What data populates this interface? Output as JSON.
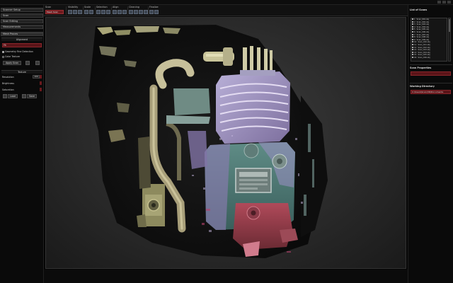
{
  "toolbar": {
    "groups": [
      {
        "label": "Scan",
        "selected": "Mesh Scan"
      },
      {
        "label": "Visibility"
      },
      {
        "label": "Scale"
      },
      {
        "label": "Selection"
      },
      {
        "label": "Align"
      },
      {
        "label": "Cleaning"
      },
      {
        "label": "Finalize"
      }
    ]
  },
  "left_panel": {
    "tabs": [
      "Scanner Setup",
      "Scan",
      "Scan Editing",
      "Measurements"
    ],
    "section_title": "Mesh Proces",
    "sub_alignment": "Alignment",
    "field_value": "Fit",
    "option_geometry": "Geometry Fine Detection",
    "option_color": "Color Texture",
    "button_apply": "Apply Scan",
    "sub_texture": "Texture",
    "label_resolution": "Resolution",
    "value_resolution": "100",
    "label_brightness": "Brightness",
    "label_saturation": "Saturation",
    "button_load": "Load",
    "button_save": "Save"
  },
  "right_panel": {
    "title_scans": "List of Scans",
    "scans": [
      {
        "id": "1",
        "name": "Scan_001.obj"
      },
      {
        "id": "2",
        "name": "Scan_002.obj"
      },
      {
        "id": "3",
        "name": "Scan_003.obj"
      },
      {
        "id": "4",
        "name": "Scan_004.obj"
      },
      {
        "id": "5",
        "name": "Scan_005.obj"
      },
      {
        "id": "6",
        "name": "Scan_006.obj"
      },
      {
        "id": "7",
        "name": "Scan_007.obj"
      },
      {
        "id": "8",
        "name": "Scan_008.obj"
      },
      {
        "id": "9",
        "name": "Scan_009.obj"
      },
      {
        "id": "10",
        "name": "Scan_010.obj"
      },
      {
        "id": "11",
        "name": "Scan_011.obj"
      },
      {
        "id": "12",
        "name": "Scan_012.obj"
      },
      {
        "id": "13",
        "name": "Scan_013.obj"
      },
      {
        "id": "14",
        "name": "Scan_014.obj"
      },
      {
        "id": "15",
        "name": "Scan_015.obj"
      },
      {
        "id": "16",
        "name": "Scan_016.obj"
      }
    ],
    "title_properties": "Scan Properties",
    "title_working": "Working Directory",
    "working_dir": "C:\\Users\\Scan\\3D\\Documents"
  },
  "colors": {
    "accent_red": "#6e1a1e",
    "panel_bg": "#0a0a0a",
    "viewport_bg": "#3a3a3a"
  }
}
